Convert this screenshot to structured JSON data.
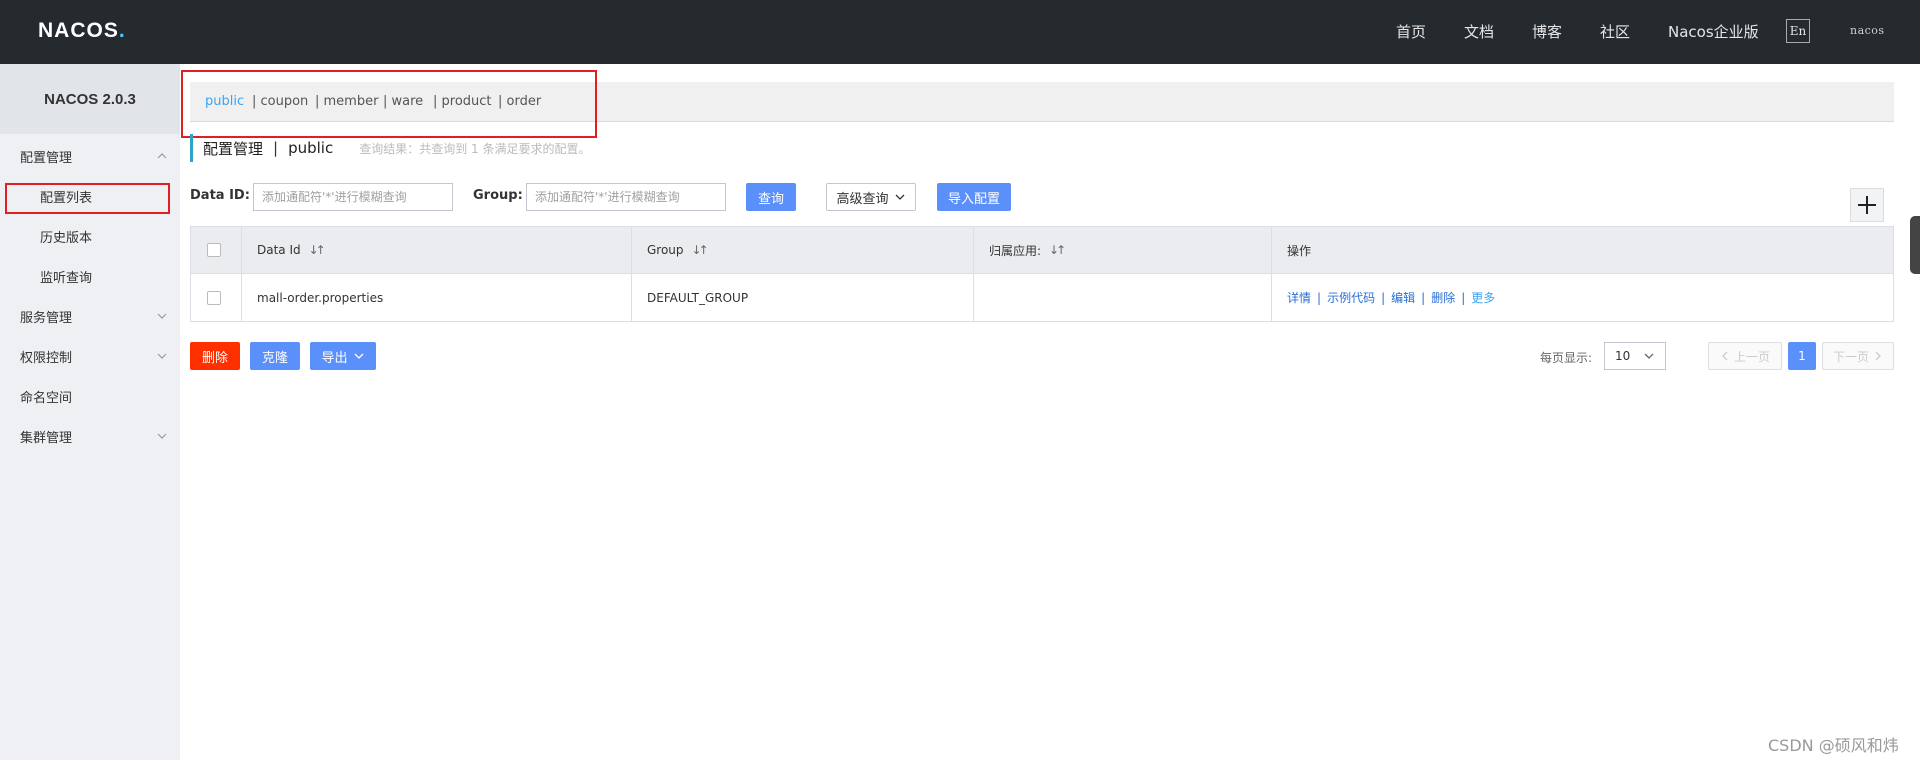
{
  "header": {
    "logo": "NACOS",
    "logo_dot": ".",
    "nav": [
      "首页",
      "文档",
      "博客",
      "社区",
      "Nacos企业版"
    ],
    "lang": "En",
    "user": "nacos"
  },
  "sidebar": {
    "version": "NACOS 2.0.3",
    "items": [
      {
        "label": "配置管理"
      },
      {
        "label": "配置列表"
      },
      {
        "label": "历史版本"
      },
      {
        "label": "监听查询"
      },
      {
        "label": "服务管理"
      },
      {
        "label": "权限控制"
      },
      {
        "label": "命名空间"
      },
      {
        "label": "集群管理"
      }
    ]
  },
  "namespaces": [
    "public",
    "| coupon",
    "| member",
    "| ware",
    "| product",
    "| order"
  ],
  "page": {
    "title": "配置管理",
    "separator": "|",
    "namespace": "public",
    "result": "查询结果：共查询到 1 条满足要求的配置。"
  },
  "filters": {
    "dataid_label": "Data ID:",
    "dataid_placeholder": "添加通配符'*'进行模糊查询",
    "group_label": "Group:",
    "group_placeholder": "添加通配符'*'进行模糊查询",
    "query": "查询",
    "advanced": "高级查询",
    "import": "导入配置"
  },
  "table": {
    "columns": [
      "Data Id",
      "Group",
      "归属应用:",
      "操作"
    ],
    "sort_icon": "↓↑",
    "rows": [
      {
        "dataid": "mall-order.properties",
        "group": "DEFAULT_GROUP",
        "app": "",
        "ops": [
          "详情",
          "示例代码",
          "编辑",
          "删除",
          "更多"
        ]
      }
    ],
    "op_separator": "|"
  },
  "actions": {
    "delete": "删除",
    "clone": "克隆",
    "export": "导出"
  },
  "pagination": {
    "label": "每页显示:",
    "page_size": "10",
    "prev": "上一页",
    "current": "1",
    "next": "下一页"
  },
  "watermark": "CSDN @硕风和炜",
  "colors": {
    "topbar": "#252a2f",
    "primary": "#5b8ff9",
    "danger": "#ff3000",
    "highlight": "#e02020",
    "active_ns": "#39a3f5"
  }
}
